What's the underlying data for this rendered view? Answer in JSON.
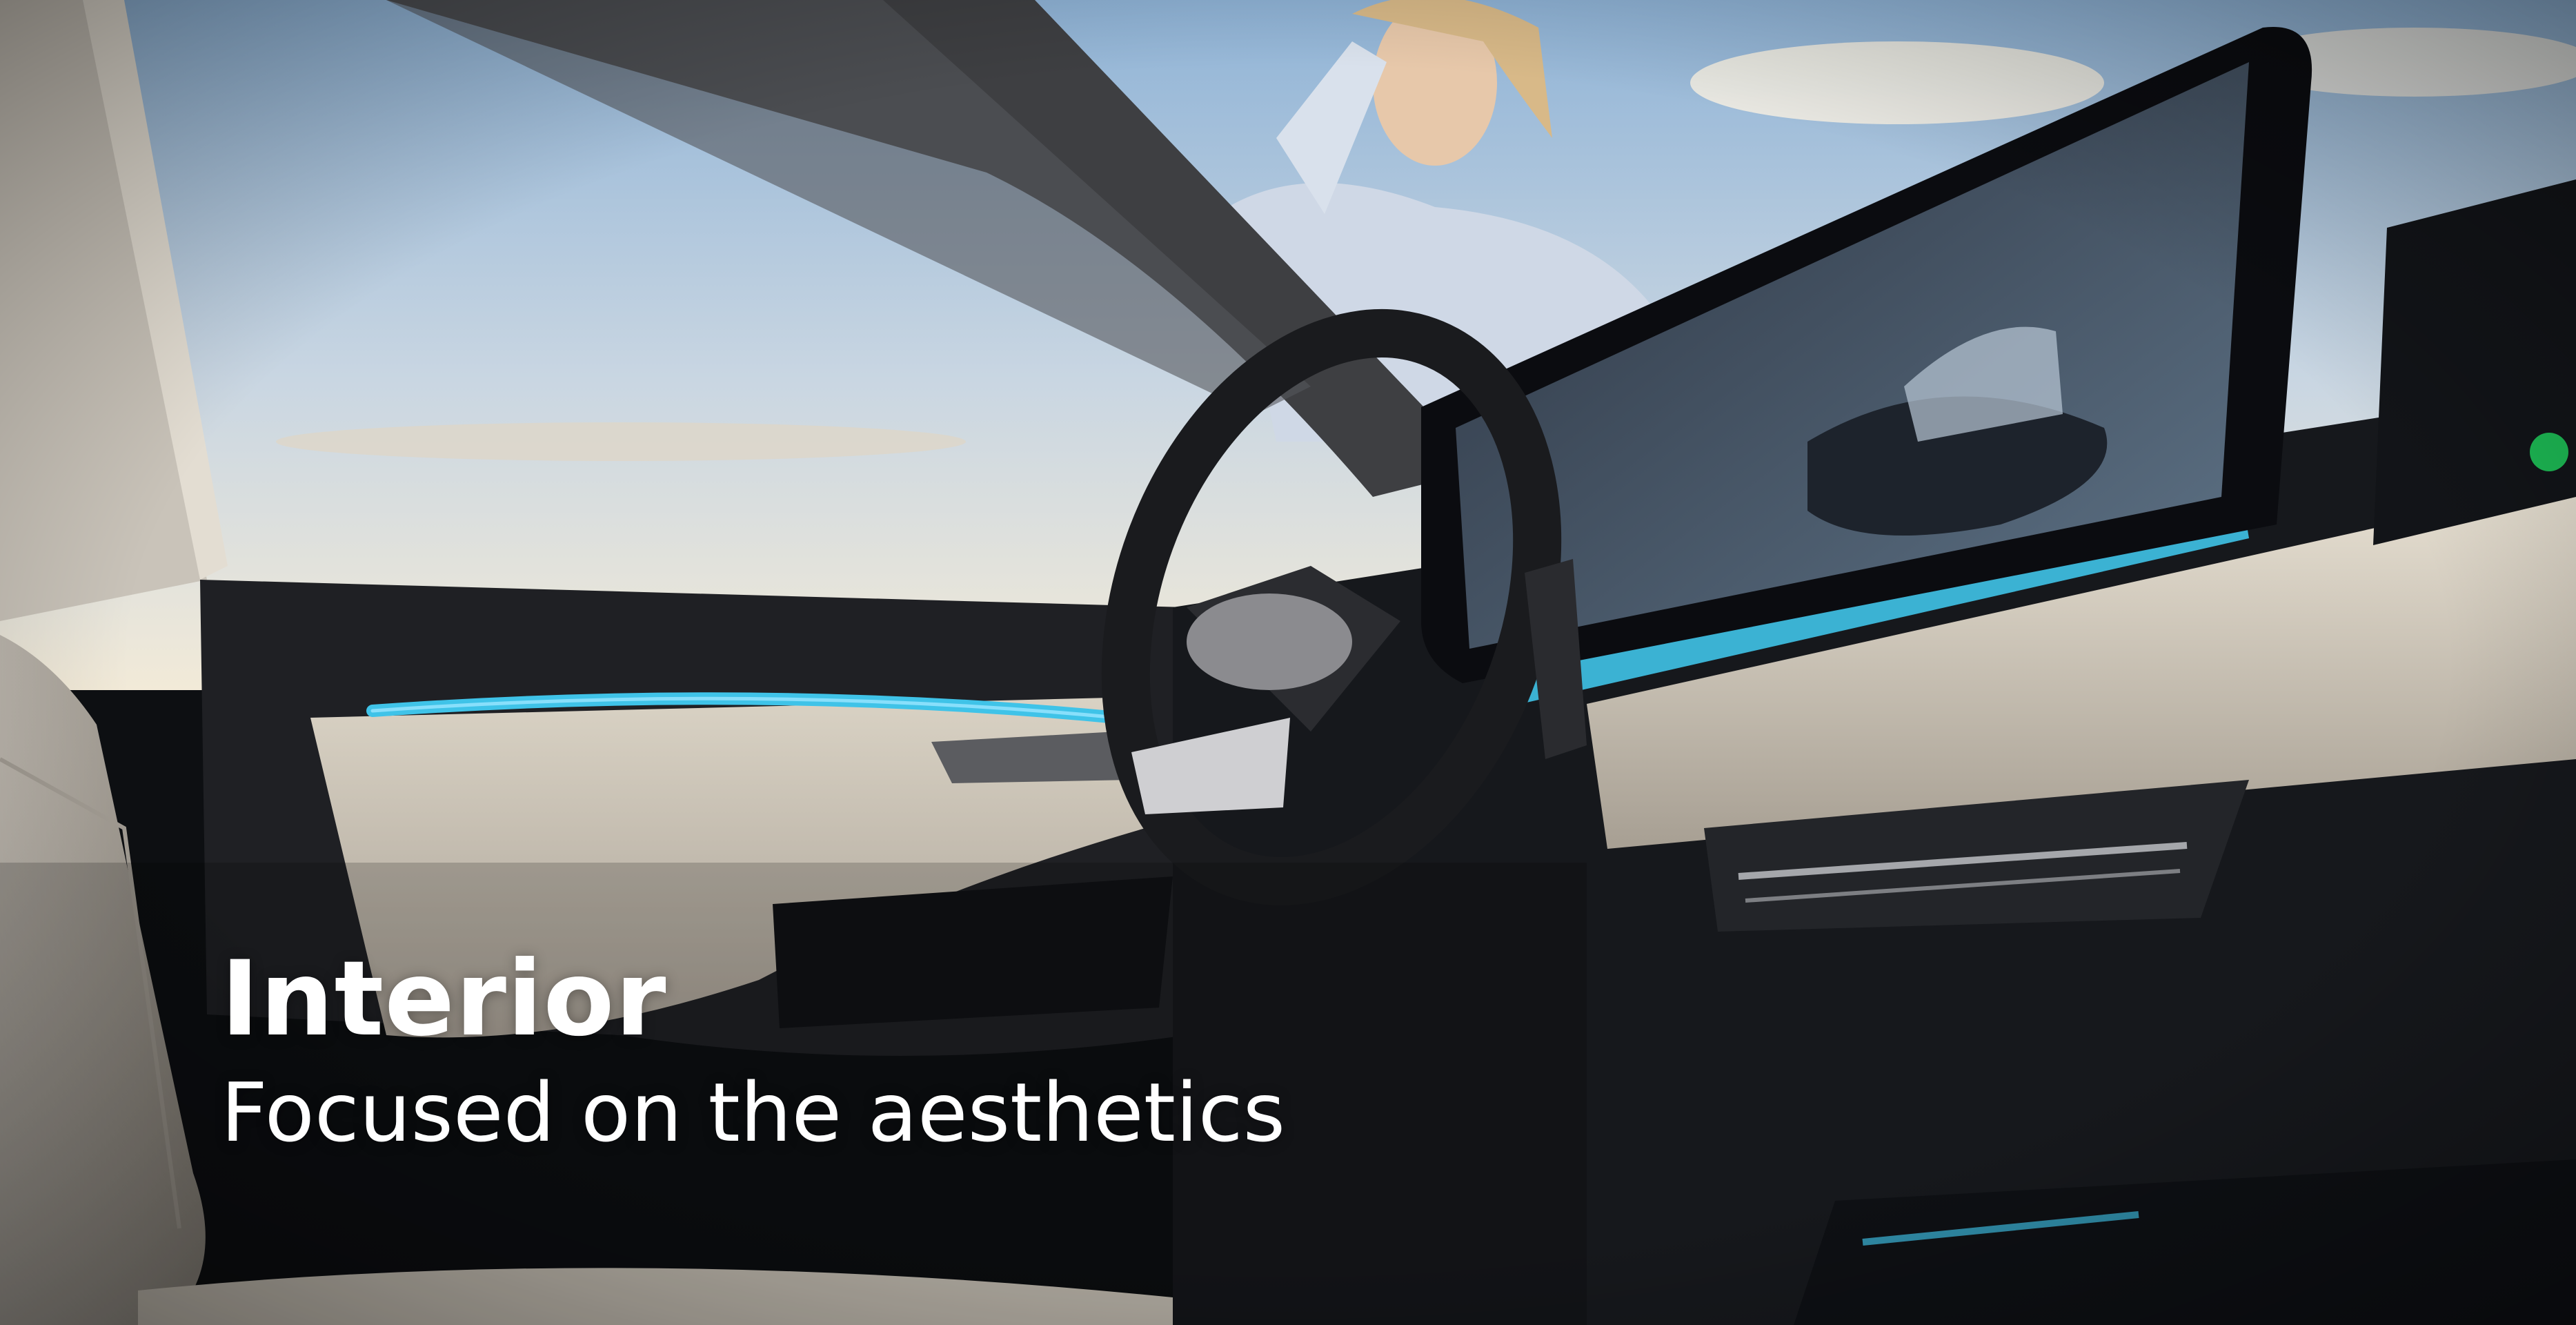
{
  "caption": {
    "heading": "Interior",
    "subheading": "Focused on the aesthetics"
  },
  "image": {
    "subject": "car-interior-photo",
    "accent_light_color": "#3fc3e8",
    "sky_top_color": "#8fb3d6",
    "sky_bottom_color": "#f2ead8",
    "trim_color": "#d9d2c4",
    "dark_surface_color": "#16181c"
  }
}
